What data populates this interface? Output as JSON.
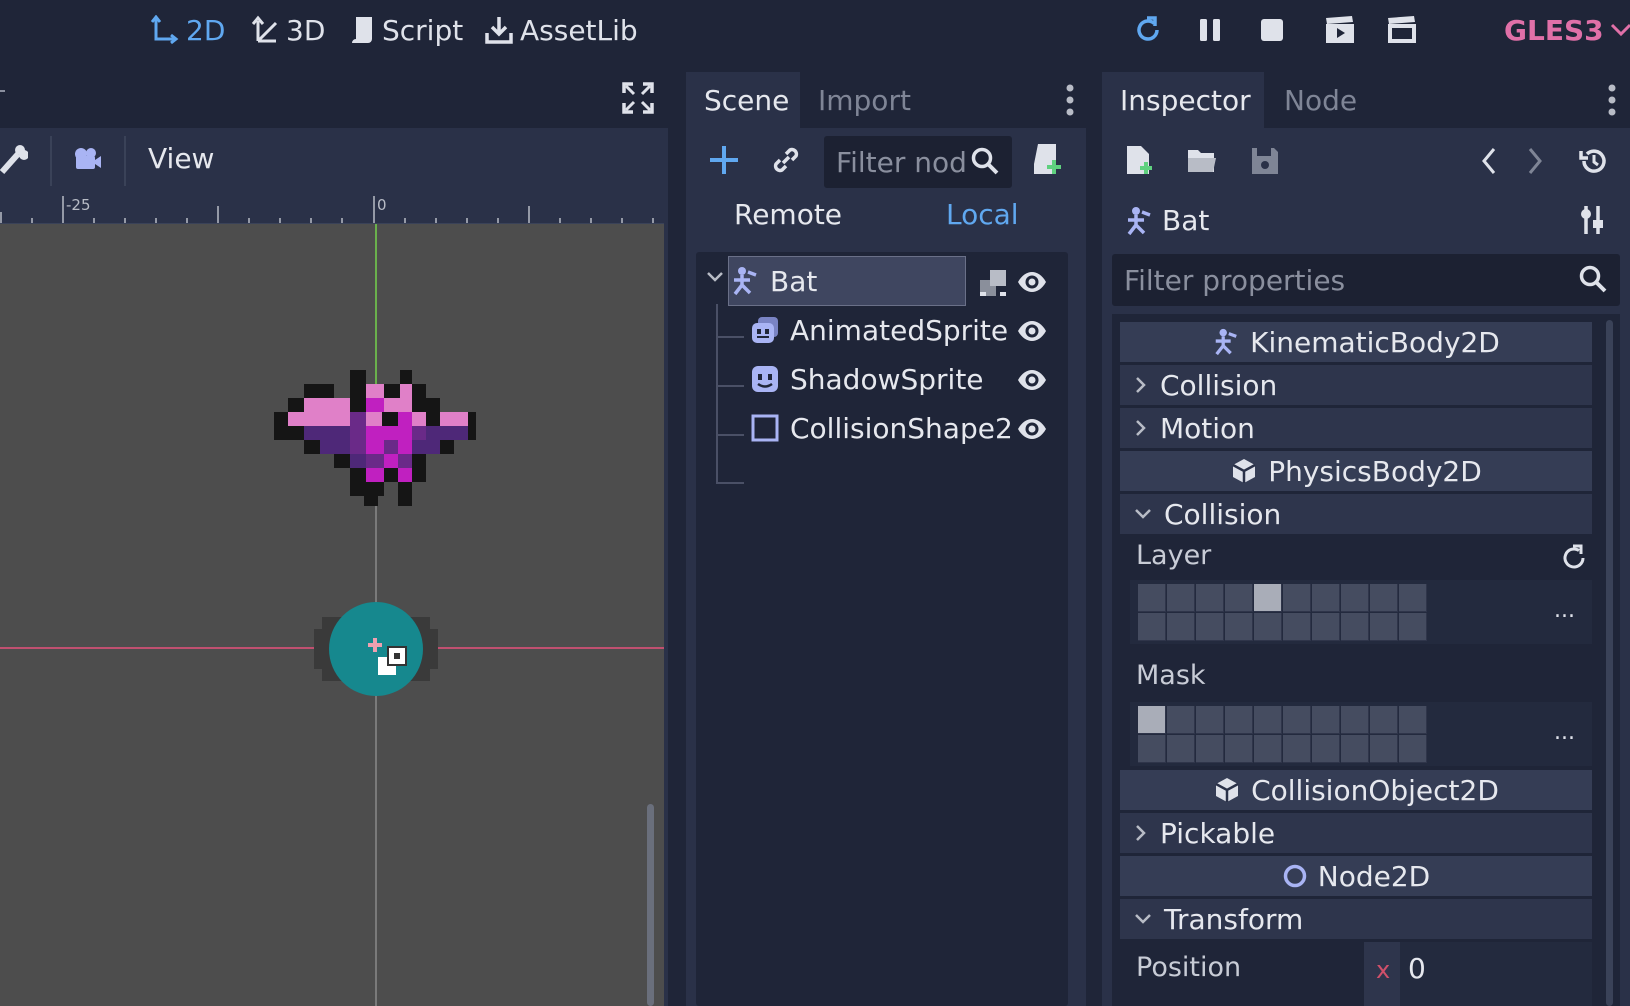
{
  "top_bar": {
    "modes": [
      {
        "label": "2D",
        "icon": "2d-axis-icon",
        "active": true
      },
      {
        "label": "3D",
        "icon": "3d-axis-icon",
        "active": false
      },
      {
        "label": "Script",
        "icon": "script-icon",
        "active": false
      },
      {
        "label": "AssetLib",
        "icon": "download-icon",
        "active": false
      }
    ],
    "renderer": "GLES3",
    "colors": {
      "active": "#60a8f0",
      "renderer": "#e070a8"
    }
  },
  "viewport": {
    "view_menu": "View",
    "ruler_labels": [
      "-25",
      "0"
    ]
  },
  "scene_dock": {
    "tabs": [
      "Scene",
      "Import"
    ],
    "filter_placeholder": "Filter nod",
    "remote_label": "Remote",
    "local_label": "Local",
    "tree": [
      {
        "name": "Bat",
        "icon": "kinematic-body-icon",
        "selected": true
      },
      {
        "name": "AnimatedSprite",
        "icon": "animated-sprite-icon"
      },
      {
        "name": "ShadowSprite",
        "icon": "sprite-icon"
      },
      {
        "name": "CollisionShape2",
        "icon": "collision-shape-icon"
      }
    ]
  },
  "inspector": {
    "tabs": [
      "Inspector",
      "Node"
    ],
    "node_name": "Bat",
    "filter_placeholder": "Filter properties",
    "sections": {
      "kinematic": "KinematicBody2D",
      "physics": "PhysicsBody2D",
      "collision_object": "CollisionObject2D",
      "node2d": "Node2D"
    },
    "groups": {
      "collision": "Collision",
      "motion": "Motion",
      "collision2": "Collision",
      "pickable": "Pickable",
      "transform": "Transform"
    },
    "layer_label": "Layer",
    "mask_label": "Mask",
    "layer_bits": [
      5
    ],
    "mask_bits": [
      1
    ],
    "more": "...",
    "position_label": "Position",
    "position_x_label": "x",
    "position_x": "0"
  }
}
